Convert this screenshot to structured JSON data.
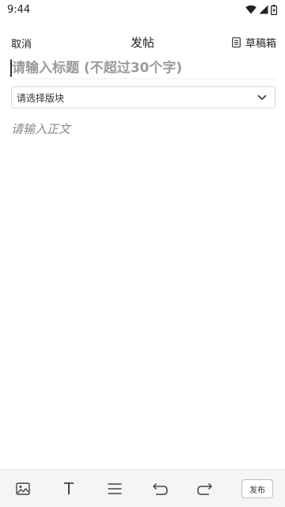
{
  "status_bar": {
    "time": "9:44"
  },
  "header": {
    "cancel_label": "取消",
    "title": "发帖",
    "drafts_label": "草稿箱"
  },
  "form": {
    "title_placeholder": "请输入标题 (不超过30个字)",
    "board_select_label": "请选择版块",
    "body_placeholder": "请输入正文"
  },
  "toolbar": {
    "text_tool_glyph": "T",
    "publish_label": "发布"
  },
  "icons": [
    "wifi-icon",
    "cellular-signal-icon",
    "battery-icon",
    "drafts-icon",
    "chevron-down-icon",
    "image-icon",
    "text-format-icon",
    "list-icon",
    "undo-icon",
    "redo-icon"
  ]
}
